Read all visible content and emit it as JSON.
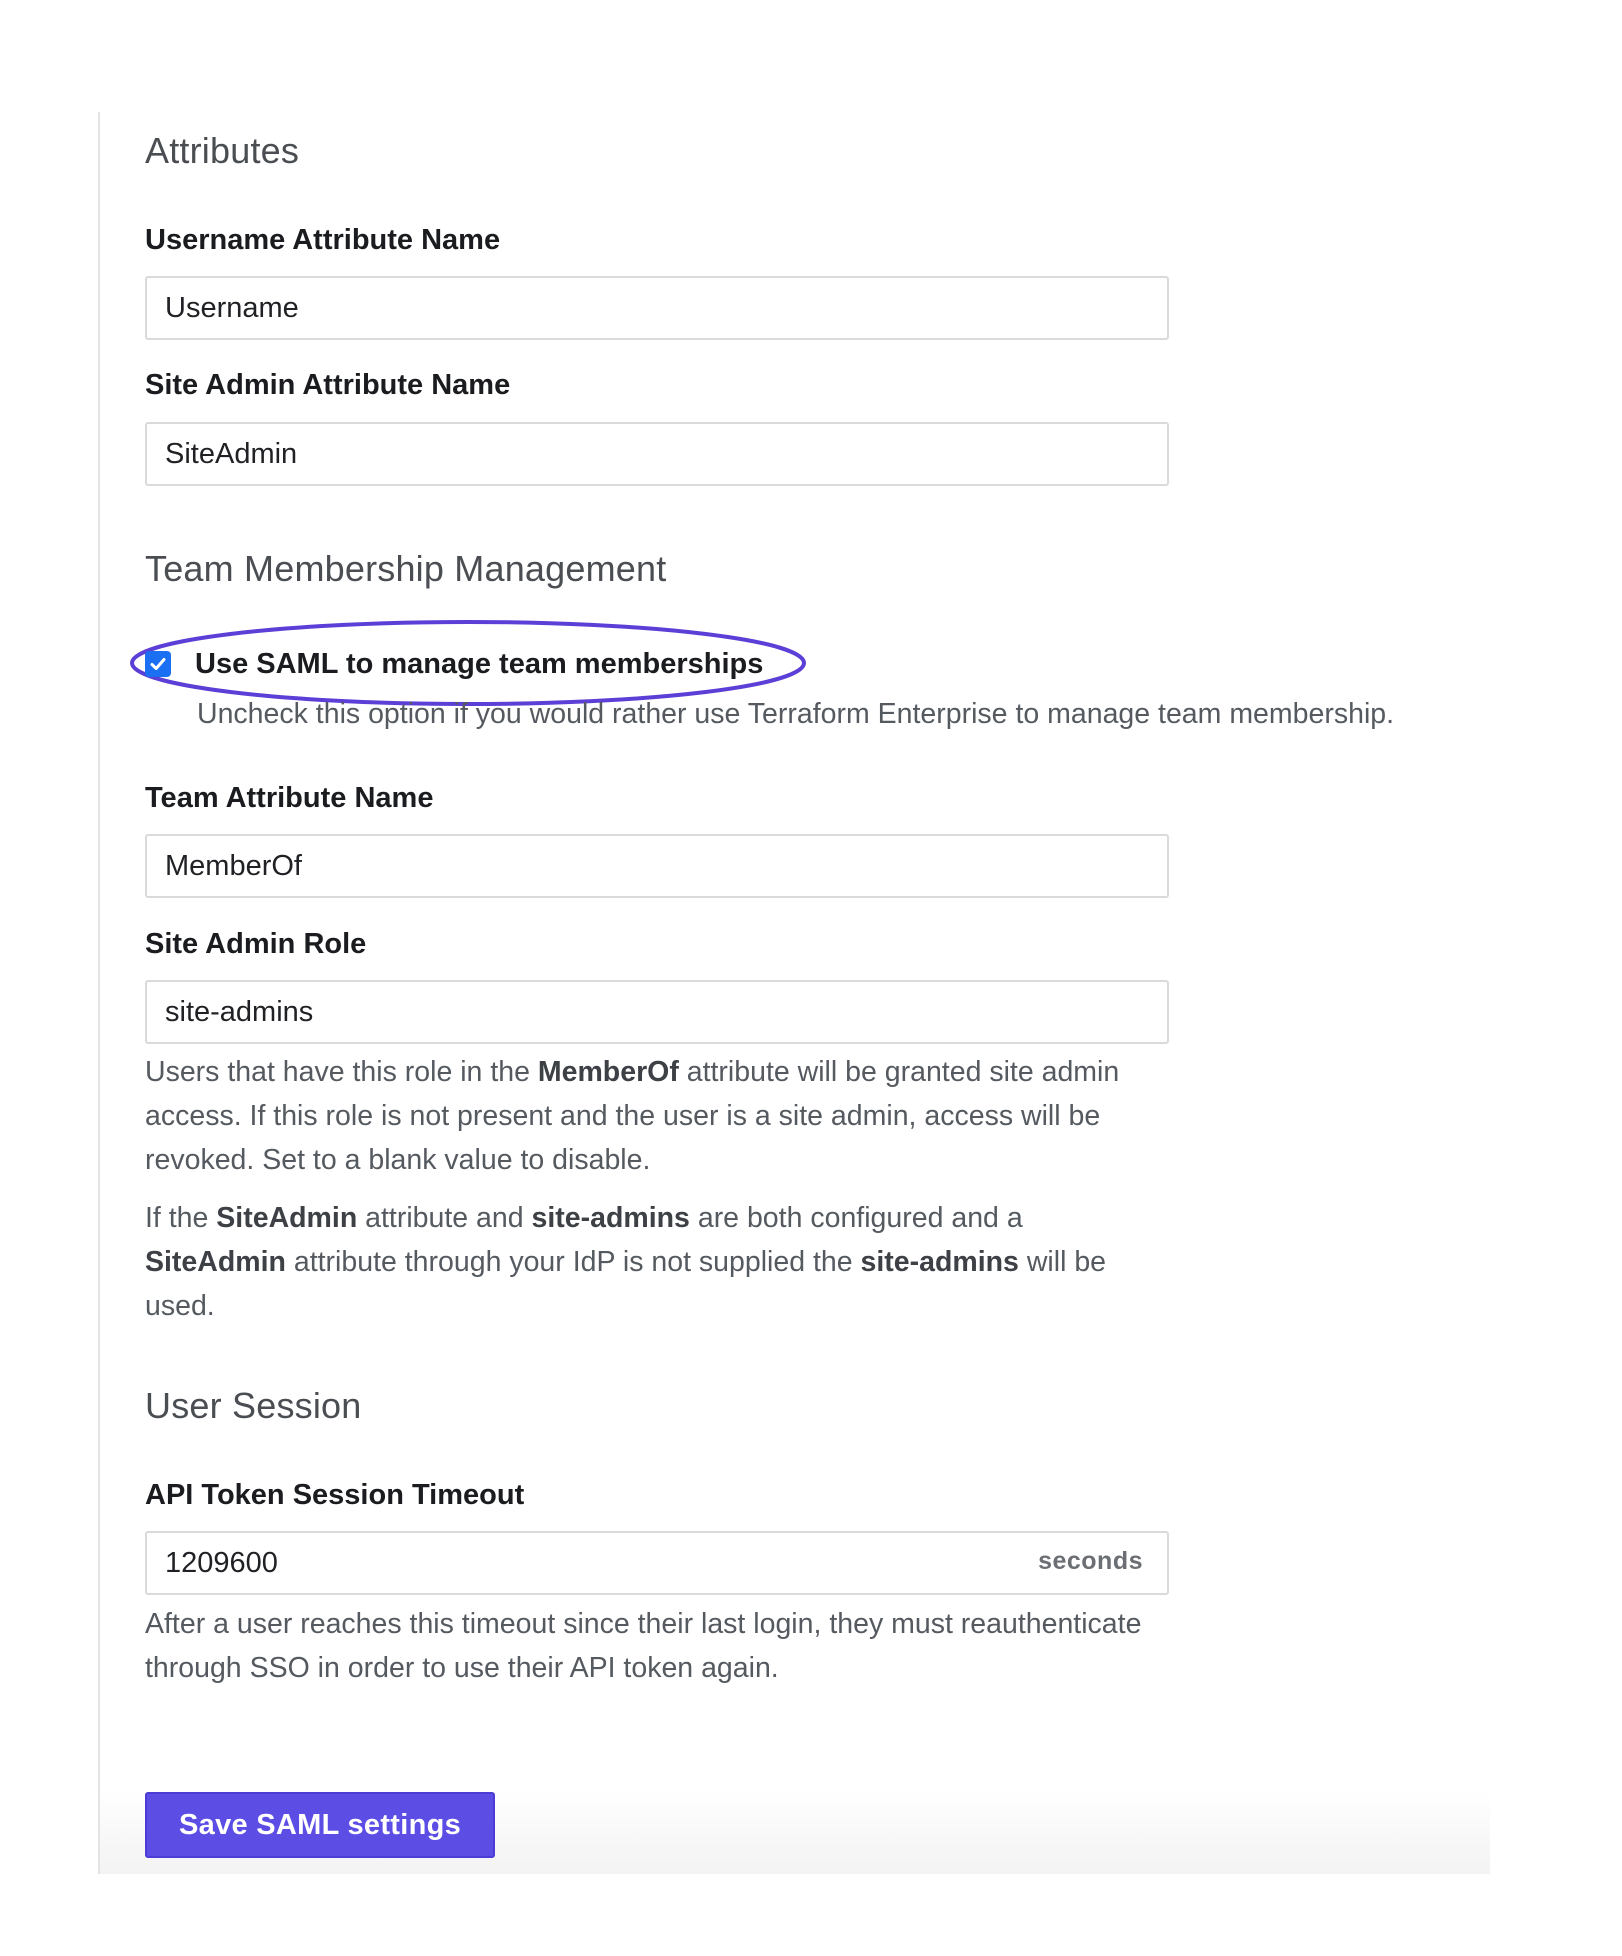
{
  "sections": {
    "attributes": {
      "title": "Attributes",
      "username_label": "Username Attribute Name",
      "username_value": "Username",
      "site_admin_label": "Site Admin Attribute Name",
      "site_admin_value": "SiteAdmin"
    },
    "team_membership": {
      "title": "Team Membership Management",
      "checkbox_label": "Use SAML to manage team memberships",
      "checkbox_checked": true,
      "checkbox_help": "Uncheck this option if you would rather use Terraform Enterprise to manage team membership.",
      "team_attr_label": "Team Attribute Name",
      "team_attr_value": "MemberOf",
      "site_admin_role_label": "Site Admin Role",
      "site_admin_role_value": "site-admins",
      "help1": {
        "p1": "Users that have this role in the ",
        "b1": "MemberOf",
        "p2": " attribute will be granted site admin access. If this role is not present and the user is a site admin, access will be revoked. Set to a blank value to disable."
      },
      "help2": {
        "p1": "If the ",
        "b1": "SiteAdmin",
        "p2": " attribute and ",
        "b2": "site-admins",
        "p3": " are both configured and a ",
        "b3": "SiteAdmin",
        "p4": " attribute through your IdP is not supplied the ",
        "b4": "site-admins",
        "p5": " will be used."
      }
    },
    "user_session": {
      "title": "User Session",
      "timeout_label": "API Token Session Timeout",
      "timeout_value": "1209600",
      "timeout_suffix": "seconds",
      "timeout_help": "After a user reaches this timeout since their last login, they must reauthenticate through SSO in order to use their API token again."
    }
  },
  "save_button_label": "Save SAML settings",
  "colors": {
    "accent": "#5c4ee5",
    "checkbox": "#1a6ff2",
    "highlight_ellipse": "#5b3fd6"
  }
}
